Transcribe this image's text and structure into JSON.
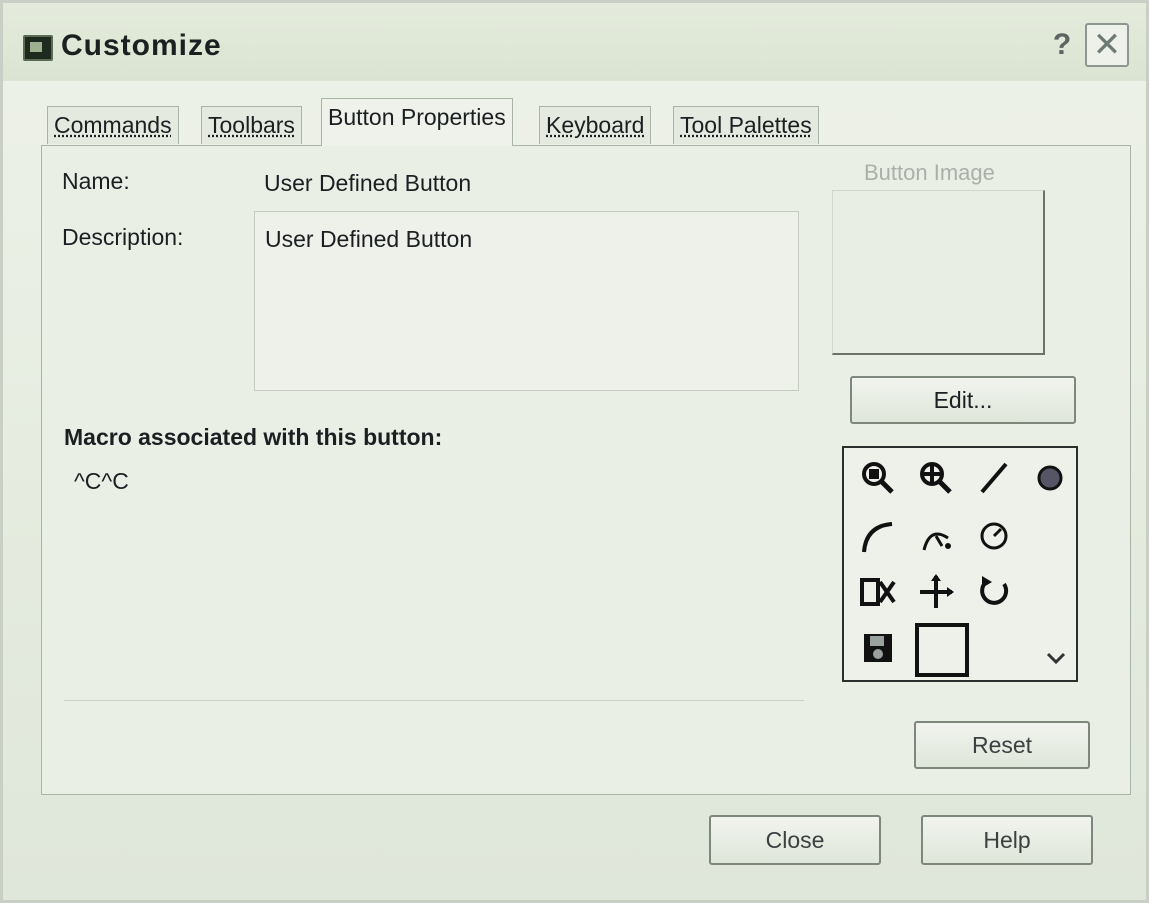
{
  "window": {
    "title": "Customize",
    "help_glyph": "?",
    "close_glyph": "✕"
  },
  "tabs": [
    {
      "label": "Commands",
      "active": false
    },
    {
      "label": "Toolbars",
      "active": false
    },
    {
      "label": "Button Properties",
      "active": true
    },
    {
      "label": "Keyboard",
      "active": false
    },
    {
      "label": "Tool Palettes",
      "active": false
    }
  ],
  "properties": {
    "name_label": "Name:",
    "name_value": "User Defined Button",
    "description_label": "Description:",
    "description_value": "User Defined Button",
    "macro_label": "Macro associated with this button:",
    "macro_value": "^C^C"
  },
  "button_image": {
    "legend": "Button Image",
    "edit_label": "Edit...",
    "reset_label": "Reset",
    "icons": [
      "zoom-window-icon",
      "zoom-realtime-icon",
      "line-icon",
      "circle-icon",
      "arc-icon",
      "arc-3point-icon",
      "circle-center-icon",
      "explode-icon",
      "move-icon",
      "rotate-icon",
      "save-icon",
      "blank-square-icon"
    ]
  },
  "footer": {
    "close_label": "Close",
    "help_label": "Help"
  }
}
